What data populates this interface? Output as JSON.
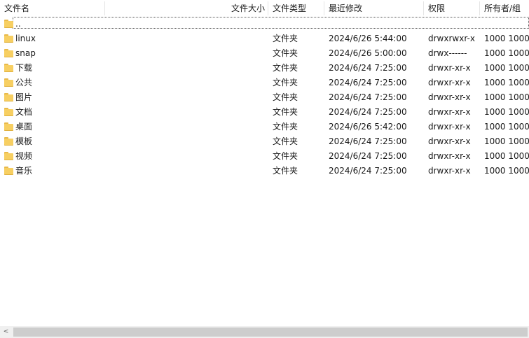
{
  "header": {
    "name": "文件名",
    "size": "文件大小",
    "type": "文件类型",
    "modified": "最近修改",
    "perms": "权限",
    "owner": "所有者/组",
    "sort_indicator": "^"
  },
  "rows": [
    {
      "name": "..",
      "type": "",
      "modified": "",
      "perms": "",
      "owner": ""
    },
    {
      "name": "linux",
      "type": "文件夹",
      "modified": "2024/6/26 5:44:00",
      "perms": "drwxrwxr-x",
      "owner": "1000 1000"
    },
    {
      "name": "snap",
      "type": "文件夹",
      "modified": "2024/6/26 5:00:00",
      "perms": "drwx------",
      "owner": "1000 1000"
    },
    {
      "name": "下载",
      "type": "文件夹",
      "modified": "2024/6/24 7:25:00",
      "perms": "drwxr-xr-x",
      "owner": "1000 1000"
    },
    {
      "name": "公共",
      "type": "文件夹",
      "modified": "2024/6/24 7:25:00",
      "perms": "drwxr-xr-x",
      "owner": "1000 1000"
    },
    {
      "name": "图片",
      "type": "文件夹",
      "modified": "2024/6/24 7:25:00",
      "perms": "drwxr-xr-x",
      "owner": "1000 1000"
    },
    {
      "name": "文档",
      "type": "文件夹",
      "modified": "2024/6/24 7:25:00",
      "perms": "drwxr-xr-x",
      "owner": "1000 1000"
    },
    {
      "name": "桌面",
      "type": "文件夹",
      "modified": "2024/6/26 5:42:00",
      "perms": "drwxr-xr-x",
      "owner": "1000 1000"
    },
    {
      "name": "模板",
      "type": "文件夹",
      "modified": "2024/6/24 7:25:00",
      "perms": "drwxr-xr-x",
      "owner": "1000 1000"
    },
    {
      "name": "视频",
      "type": "文件夹",
      "modified": "2024/6/24 7:25:00",
      "perms": "drwxr-xr-x",
      "owner": "1000 1000"
    },
    {
      "name": "音乐",
      "type": "文件夹",
      "modified": "2024/6/24 7:25:00",
      "perms": "drwxr-xr-x",
      "owner": "1000 1000"
    }
  ],
  "scrollbar": {
    "left_arrow": "<"
  },
  "colors": {
    "folder": "#f7cf62",
    "folder_tab": "#e8b94a",
    "scrollbar_thumb": "#cdcdcd"
  }
}
